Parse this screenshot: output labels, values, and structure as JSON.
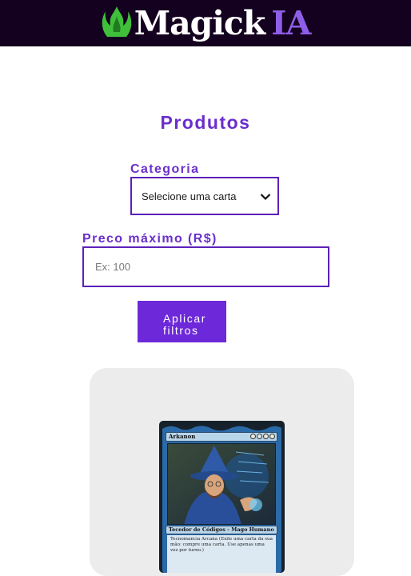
{
  "header": {
    "logo_text": "Magick",
    "logo_accent": "IA",
    "logo_icon": "green-flame-crown-icon",
    "background_color": "#14001f"
  },
  "main": {
    "title": "Produtos",
    "filters": {
      "category_label": "Categoria",
      "category_selected": "Selecione uma carta",
      "price_label": "Preco máximo (R$)",
      "price_placeholder": "Ex: 100",
      "price_value": "",
      "apply_button": "Aplicar filtros"
    },
    "product": {
      "card_name": "Arkanon",
      "card_type": "Tecedor de Códigos - Mago Humano",
      "card_text": "Tecnomancia Arcana (Exile uma carta da sua mão: compre uma carta. Use apenas uma vez por turno.)"
    }
  },
  "colors": {
    "accent": "#6b2fcc",
    "button": "#6d28d9",
    "border": "#5c21b8",
    "logo_green": "#3fbf3a"
  }
}
